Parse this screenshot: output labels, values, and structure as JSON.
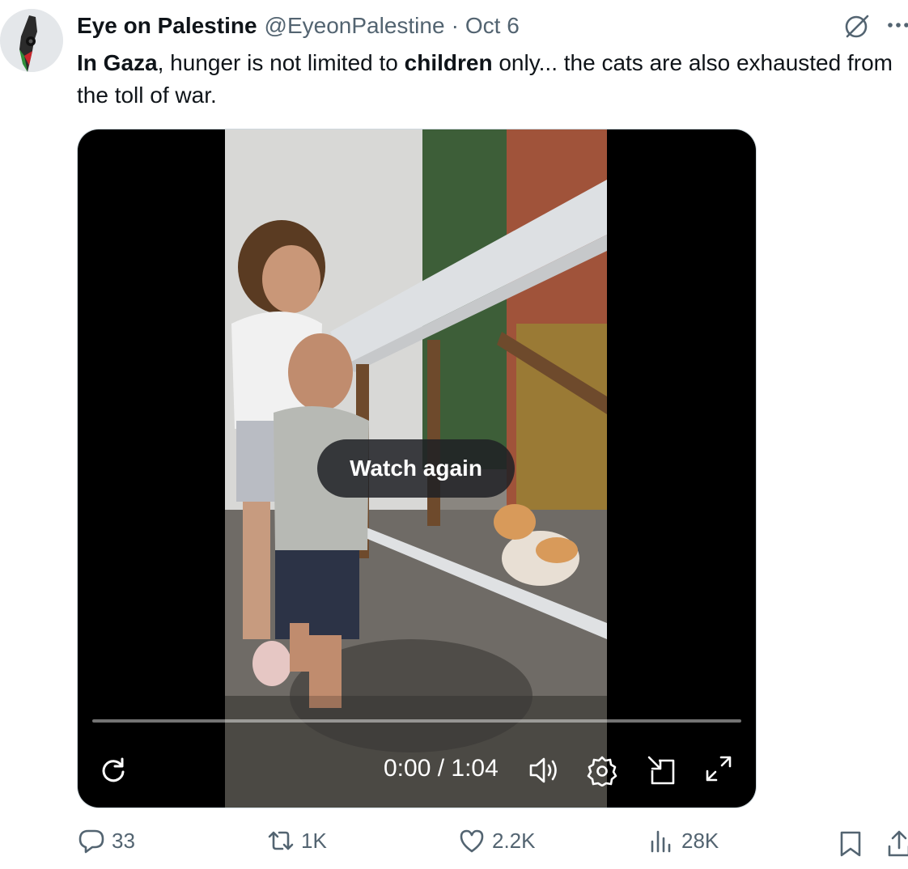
{
  "author": {
    "display_name": "Eye on Palestine",
    "handle": "@EyeonPalestine",
    "separator": "·",
    "date": "Oct 6"
  },
  "tweet": {
    "parts": [
      {
        "text": "In Gaza",
        "bold": true
      },
      {
        "text": ", hunger is not limited to ",
        "bold": false
      },
      {
        "text": "children",
        "bold": true
      },
      {
        "text": " only... the cats are also exhausted from the toll of war.",
        "bold": false
      }
    ]
  },
  "video": {
    "overlay_label": "Watch again",
    "time": "0:00 / 1:04",
    "progress": 0
  },
  "actions": {
    "replies": "33",
    "reposts": "1K",
    "likes": "2.2K",
    "views": "28K"
  },
  "colors": {
    "text": "#0f1419",
    "secondary": "#536471",
    "border": "#cfd9de"
  },
  "icons": [
    "grok-icon",
    "more-icon",
    "replay-icon",
    "volume-icon",
    "settings-icon",
    "dock-icon",
    "fullscreen-icon",
    "reply-icon",
    "repost-icon",
    "like-icon",
    "views-icon",
    "bookmark-icon",
    "share-icon"
  ]
}
